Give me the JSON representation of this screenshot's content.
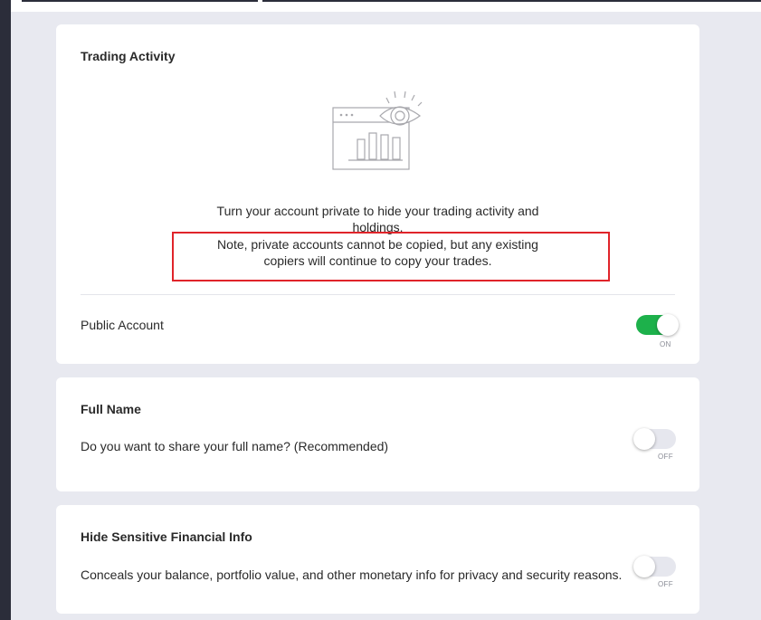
{
  "trading_activity": {
    "title": "Trading Activity",
    "description_line1": "Turn your account private to hide your trading activity and",
    "description_line2": "holdings.",
    "note_line1": "Note, private accounts cannot be copied, but any existing",
    "note_line2": "copiers will continue to copy your trades.",
    "public_account_label": "Public Account",
    "public_account_state": "ON",
    "public_account_enabled": true
  },
  "full_name": {
    "title": "Full Name",
    "question": "Do you want to share your full name? (Recommended)",
    "state": "OFF",
    "enabled": false
  },
  "hide_sensitive": {
    "title": "Hide Sensitive Financial Info",
    "description": "Conceals your balance, portfolio value, and other monetary info for privacy and security reasons.",
    "state": "OFF",
    "enabled": false
  },
  "colors": {
    "toggle_on": "#1db14b",
    "toggle_off": "#e6e7ee",
    "highlight": "#e0242a",
    "background": "#e8e9f0"
  },
  "icons": {
    "illustration": "eye-over-chart-icon"
  }
}
